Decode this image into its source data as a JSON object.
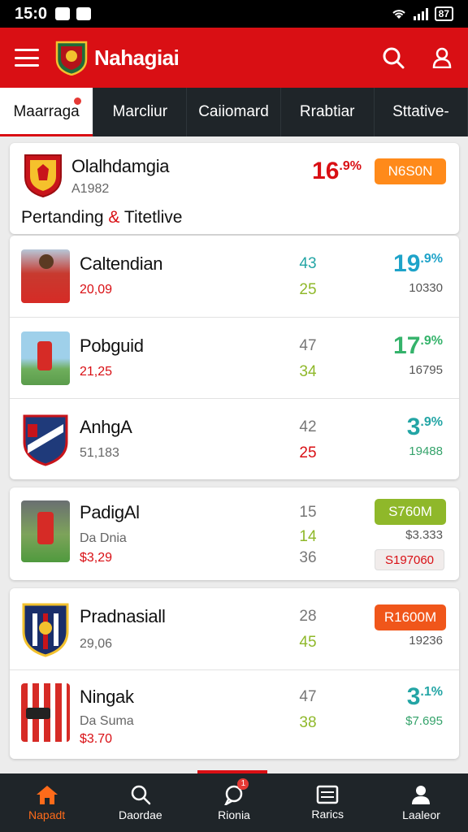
{
  "status": {
    "time": "15:0",
    "battery": "87"
  },
  "app": {
    "title": "Nahagiai"
  },
  "tabs": [
    {
      "label": "Maarraga",
      "active": true
    },
    {
      "label": "Marcliur"
    },
    {
      "label": "Caiiomard"
    },
    {
      "label": "Rrabtiar"
    },
    {
      "label": "Sttative-"
    }
  ],
  "featured": {
    "name": "Olalhdamgia",
    "code": "A1982",
    "percent": "16",
    "percent_sup": ".9%",
    "badge": "N6S0N",
    "caption_left": "Pertanding",
    "caption_amp": "&",
    "caption_right": "Titetlive"
  },
  "group1": [
    {
      "name": "Caltendian",
      "sub": "20,09",
      "n1": "43",
      "n2": "25",
      "pct": "19",
      "pct_sup": ".9%",
      "small": "10330"
    },
    {
      "name": "Pobguid",
      "sub": "21,25",
      "n1": "47",
      "n2": "34",
      "pct": "17",
      "pct_sup": ".9%",
      "small": "16795"
    },
    {
      "name": "AnhgA",
      "sub": "51,183",
      "n1": "42",
      "n2": "25",
      "pct": "3",
      "pct_sup": ".9%",
      "small": "19488"
    }
  ],
  "group2": {
    "name": "PadigAl",
    "sub1": "Da Dnia",
    "sub2": "$3,29",
    "n1": "15",
    "n2": "14",
    "n3": "36",
    "badge": "S760M",
    "small": "$3.333",
    "badge2": "S197060"
  },
  "group3": [
    {
      "name": "Pradnasiall",
      "sub": "29,06",
      "n1": "28",
      "n2": "45",
      "badge": "R1600M",
      "small": "19236"
    },
    {
      "name": "Ningak",
      "sub1": "Da Suma",
      "sub2": "$3.70",
      "n1": "47",
      "n2": "38",
      "pct": "3",
      "pct_sup": ".1%",
      "small": "$7.695"
    }
  ],
  "nav": [
    {
      "label": "Napadt",
      "icon": "home-icon",
      "active": true
    },
    {
      "label": "Daordae",
      "icon": "search-icon"
    },
    {
      "label": "Rionia",
      "icon": "chat-icon",
      "badge": "1"
    },
    {
      "label": "Rarics",
      "icon": "list-icon"
    },
    {
      "label": "Laaleor",
      "icon": "profile-icon"
    }
  ],
  "colors": {
    "primary": "#d90f14",
    "dark": "#1f2529",
    "orange": "#ff8a1a",
    "green": "#8fb82a",
    "teal": "#23a5a5"
  }
}
